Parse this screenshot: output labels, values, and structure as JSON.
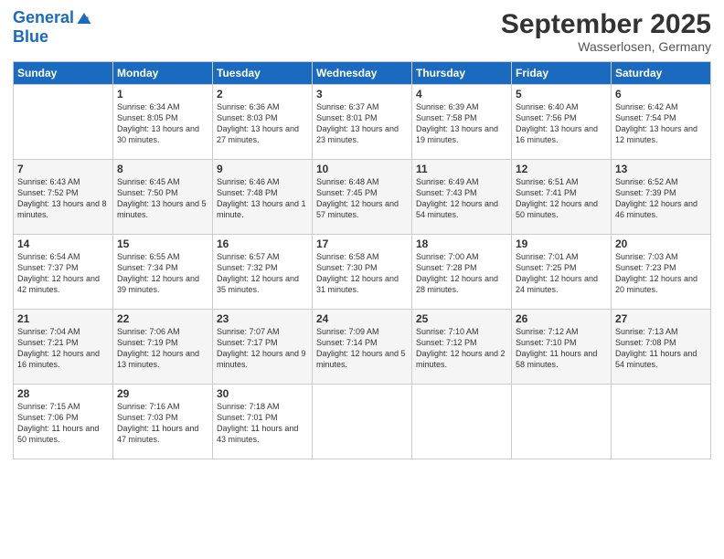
{
  "logo": {
    "line1": "General",
    "line2": "Blue"
  },
  "title": "September 2025",
  "location": "Wasserlosen, Germany",
  "headers": [
    "Sunday",
    "Monday",
    "Tuesday",
    "Wednesday",
    "Thursday",
    "Friday",
    "Saturday"
  ],
  "rows": [
    [
      {
        "day": "",
        "sunrise": "",
        "sunset": "",
        "daylight": ""
      },
      {
        "day": "1",
        "sunrise": "Sunrise: 6:34 AM",
        "sunset": "Sunset: 8:05 PM",
        "daylight": "Daylight: 13 hours and 30 minutes."
      },
      {
        "day": "2",
        "sunrise": "Sunrise: 6:36 AM",
        "sunset": "Sunset: 8:03 PM",
        "daylight": "Daylight: 13 hours and 27 minutes."
      },
      {
        "day": "3",
        "sunrise": "Sunrise: 6:37 AM",
        "sunset": "Sunset: 8:01 PM",
        "daylight": "Daylight: 13 hours and 23 minutes."
      },
      {
        "day": "4",
        "sunrise": "Sunrise: 6:39 AM",
        "sunset": "Sunset: 7:58 PM",
        "daylight": "Daylight: 13 hours and 19 minutes."
      },
      {
        "day": "5",
        "sunrise": "Sunrise: 6:40 AM",
        "sunset": "Sunset: 7:56 PM",
        "daylight": "Daylight: 13 hours and 16 minutes."
      },
      {
        "day": "6",
        "sunrise": "Sunrise: 6:42 AM",
        "sunset": "Sunset: 7:54 PM",
        "daylight": "Daylight: 13 hours and 12 minutes."
      }
    ],
    [
      {
        "day": "7",
        "sunrise": "Sunrise: 6:43 AM",
        "sunset": "Sunset: 7:52 PM",
        "daylight": "Daylight: 13 hours and 8 minutes."
      },
      {
        "day": "8",
        "sunrise": "Sunrise: 6:45 AM",
        "sunset": "Sunset: 7:50 PM",
        "daylight": "Daylight: 13 hours and 5 minutes."
      },
      {
        "day": "9",
        "sunrise": "Sunrise: 6:46 AM",
        "sunset": "Sunset: 7:48 PM",
        "daylight": "Daylight: 13 hours and 1 minute."
      },
      {
        "day": "10",
        "sunrise": "Sunrise: 6:48 AM",
        "sunset": "Sunset: 7:45 PM",
        "daylight": "Daylight: 12 hours and 57 minutes."
      },
      {
        "day": "11",
        "sunrise": "Sunrise: 6:49 AM",
        "sunset": "Sunset: 7:43 PM",
        "daylight": "Daylight: 12 hours and 54 minutes."
      },
      {
        "day": "12",
        "sunrise": "Sunrise: 6:51 AM",
        "sunset": "Sunset: 7:41 PM",
        "daylight": "Daylight: 12 hours and 50 minutes."
      },
      {
        "day": "13",
        "sunrise": "Sunrise: 6:52 AM",
        "sunset": "Sunset: 7:39 PM",
        "daylight": "Daylight: 12 hours and 46 minutes."
      }
    ],
    [
      {
        "day": "14",
        "sunrise": "Sunrise: 6:54 AM",
        "sunset": "Sunset: 7:37 PM",
        "daylight": "Daylight: 12 hours and 42 minutes."
      },
      {
        "day": "15",
        "sunrise": "Sunrise: 6:55 AM",
        "sunset": "Sunset: 7:34 PM",
        "daylight": "Daylight: 12 hours and 39 minutes."
      },
      {
        "day": "16",
        "sunrise": "Sunrise: 6:57 AM",
        "sunset": "Sunset: 7:32 PM",
        "daylight": "Daylight: 12 hours and 35 minutes."
      },
      {
        "day": "17",
        "sunrise": "Sunrise: 6:58 AM",
        "sunset": "Sunset: 7:30 PM",
        "daylight": "Daylight: 12 hours and 31 minutes."
      },
      {
        "day": "18",
        "sunrise": "Sunrise: 7:00 AM",
        "sunset": "Sunset: 7:28 PM",
        "daylight": "Daylight: 12 hours and 28 minutes."
      },
      {
        "day": "19",
        "sunrise": "Sunrise: 7:01 AM",
        "sunset": "Sunset: 7:25 PM",
        "daylight": "Daylight: 12 hours and 24 minutes."
      },
      {
        "day": "20",
        "sunrise": "Sunrise: 7:03 AM",
        "sunset": "Sunset: 7:23 PM",
        "daylight": "Daylight: 12 hours and 20 minutes."
      }
    ],
    [
      {
        "day": "21",
        "sunrise": "Sunrise: 7:04 AM",
        "sunset": "Sunset: 7:21 PM",
        "daylight": "Daylight: 12 hours and 16 minutes."
      },
      {
        "day": "22",
        "sunrise": "Sunrise: 7:06 AM",
        "sunset": "Sunset: 7:19 PM",
        "daylight": "Daylight: 12 hours and 13 minutes."
      },
      {
        "day": "23",
        "sunrise": "Sunrise: 7:07 AM",
        "sunset": "Sunset: 7:17 PM",
        "daylight": "Daylight: 12 hours and 9 minutes."
      },
      {
        "day": "24",
        "sunrise": "Sunrise: 7:09 AM",
        "sunset": "Sunset: 7:14 PM",
        "daylight": "Daylight: 12 hours and 5 minutes."
      },
      {
        "day": "25",
        "sunrise": "Sunrise: 7:10 AM",
        "sunset": "Sunset: 7:12 PM",
        "daylight": "Daylight: 12 hours and 2 minutes."
      },
      {
        "day": "26",
        "sunrise": "Sunrise: 7:12 AM",
        "sunset": "Sunset: 7:10 PM",
        "daylight": "Daylight: 11 hours and 58 minutes."
      },
      {
        "day": "27",
        "sunrise": "Sunrise: 7:13 AM",
        "sunset": "Sunset: 7:08 PM",
        "daylight": "Daylight: 11 hours and 54 minutes."
      }
    ],
    [
      {
        "day": "28",
        "sunrise": "Sunrise: 7:15 AM",
        "sunset": "Sunset: 7:06 PM",
        "daylight": "Daylight: 11 hours and 50 minutes."
      },
      {
        "day": "29",
        "sunrise": "Sunrise: 7:16 AM",
        "sunset": "Sunset: 7:03 PM",
        "daylight": "Daylight: 11 hours and 47 minutes."
      },
      {
        "day": "30",
        "sunrise": "Sunrise: 7:18 AM",
        "sunset": "Sunset: 7:01 PM",
        "daylight": "Daylight: 11 hours and 43 minutes."
      },
      {
        "day": "",
        "sunrise": "",
        "sunset": "",
        "daylight": ""
      },
      {
        "day": "",
        "sunrise": "",
        "sunset": "",
        "daylight": ""
      },
      {
        "day": "",
        "sunrise": "",
        "sunset": "",
        "daylight": ""
      },
      {
        "day": "",
        "sunrise": "",
        "sunset": "",
        "daylight": ""
      }
    ]
  ]
}
